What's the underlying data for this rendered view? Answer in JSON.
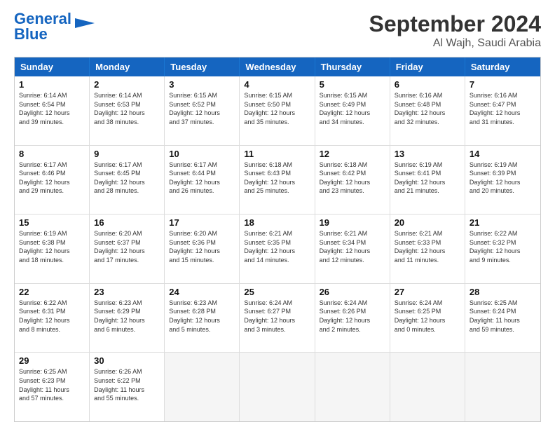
{
  "header": {
    "logo_line1": "General",
    "logo_line2": "Blue",
    "month": "September 2024",
    "location": "Al Wajh, Saudi Arabia"
  },
  "weekdays": [
    "Sunday",
    "Monday",
    "Tuesday",
    "Wednesday",
    "Thursday",
    "Friday",
    "Saturday"
  ],
  "rows": [
    [
      {
        "day": "1",
        "text": "Sunrise: 6:14 AM\nSunset: 6:54 PM\nDaylight: 12 hours\nand 39 minutes."
      },
      {
        "day": "2",
        "text": "Sunrise: 6:14 AM\nSunset: 6:53 PM\nDaylight: 12 hours\nand 38 minutes."
      },
      {
        "day": "3",
        "text": "Sunrise: 6:15 AM\nSunset: 6:52 PM\nDaylight: 12 hours\nand 37 minutes."
      },
      {
        "day": "4",
        "text": "Sunrise: 6:15 AM\nSunset: 6:50 PM\nDaylight: 12 hours\nand 35 minutes."
      },
      {
        "day": "5",
        "text": "Sunrise: 6:15 AM\nSunset: 6:49 PM\nDaylight: 12 hours\nand 34 minutes."
      },
      {
        "day": "6",
        "text": "Sunrise: 6:16 AM\nSunset: 6:48 PM\nDaylight: 12 hours\nand 32 minutes."
      },
      {
        "day": "7",
        "text": "Sunrise: 6:16 AM\nSunset: 6:47 PM\nDaylight: 12 hours\nand 31 minutes."
      }
    ],
    [
      {
        "day": "8",
        "text": "Sunrise: 6:17 AM\nSunset: 6:46 PM\nDaylight: 12 hours\nand 29 minutes."
      },
      {
        "day": "9",
        "text": "Sunrise: 6:17 AM\nSunset: 6:45 PM\nDaylight: 12 hours\nand 28 minutes."
      },
      {
        "day": "10",
        "text": "Sunrise: 6:17 AM\nSunset: 6:44 PM\nDaylight: 12 hours\nand 26 minutes."
      },
      {
        "day": "11",
        "text": "Sunrise: 6:18 AM\nSunset: 6:43 PM\nDaylight: 12 hours\nand 25 minutes."
      },
      {
        "day": "12",
        "text": "Sunrise: 6:18 AM\nSunset: 6:42 PM\nDaylight: 12 hours\nand 23 minutes."
      },
      {
        "day": "13",
        "text": "Sunrise: 6:19 AM\nSunset: 6:41 PM\nDaylight: 12 hours\nand 21 minutes."
      },
      {
        "day": "14",
        "text": "Sunrise: 6:19 AM\nSunset: 6:39 PM\nDaylight: 12 hours\nand 20 minutes."
      }
    ],
    [
      {
        "day": "15",
        "text": "Sunrise: 6:19 AM\nSunset: 6:38 PM\nDaylight: 12 hours\nand 18 minutes."
      },
      {
        "day": "16",
        "text": "Sunrise: 6:20 AM\nSunset: 6:37 PM\nDaylight: 12 hours\nand 17 minutes."
      },
      {
        "day": "17",
        "text": "Sunrise: 6:20 AM\nSunset: 6:36 PM\nDaylight: 12 hours\nand 15 minutes."
      },
      {
        "day": "18",
        "text": "Sunrise: 6:21 AM\nSunset: 6:35 PM\nDaylight: 12 hours\nand 14 minutes."
      },
      {
        "day": "19",
        "text": "Sunrise: 6:21 AM\nSunset: 6:34 PM\nDaylight: 12 hours\nand 12 minutes."
      },
      {
        "day": "20",
        "text": "Sunrise: 6:21 AM\nSunset: 6:33 PM\nDaylight: 12 hours\nand 11 minutes."
      },
      {
        "day": "21",
        "text": "Sunrise: 6:22 AM\nSunset: 6:32 PM\nDaylight: 12 hours\nand 9 minutes."
      }
    ],
    [
      {
        "day": "22",
        "text": "Sunrise: 6:22 AM\nSunset: 6:31 PM\nDaylight: 12 hours\nand 8 minutes."
      },
      {
        "day": "23",
        "text": "Sunrise: 6:23 AM\nSunset: 6:29 PM\nDaylight: 12 hours\nand 6 minutes."
      },
      {
        "day": "24",
        "text": "Sunrise: 6:23 AM\nSunset: 6:28 PM\nDaylight: 12 hours\nand 5 minutes."
      },
      {
        "day": "25",
        "text": "Sunrise: 6:24 AM\nSunset: 6:27 PM\nDaylight: 12 hours\nand 3 minutes."
      },
      {
        "day": "26",
        "text": "Sunrise: 6:24 AM\nSunset: 6:26 PM\nDaylight: 12 hours\nand 2 minutes."
      },
      {
        "day": "27",
        "text": "Sunrise: 6:24 AM\nSunset: 6:25 PM\nDaylight: 12 hours\nand 0 minutes."
      },
      {
        "day": "28",
        "text": "Sunrise: 6:25 AM\nSunset: 6:24 PM\nDaylight: 11 hours\nand 59 minutes."
      }
    ],
    [
      {
        "day": "29",
        "text": "Sunrise: 6:25 AM\nSunset: 6:23 PM\nDaylight: 11 hours\nand 57 minutes."
      },
      {
        "day": "30",
        "text": "Sunrise: 6:26 AM\nSunset: 6:22 PM\nDaylight: 11 hours\nand 55 minutes."
      },
      {
        "day": "",
        "text": ""
      },
      {
        "day": "",
        "text": ""
      },
      {
        "day": "",
        "text": ""
      },
      {
        "day": "",
        "text": ""
      },
      {
        "day": "",
        "text": ""
      }
    ]
  ]
}
